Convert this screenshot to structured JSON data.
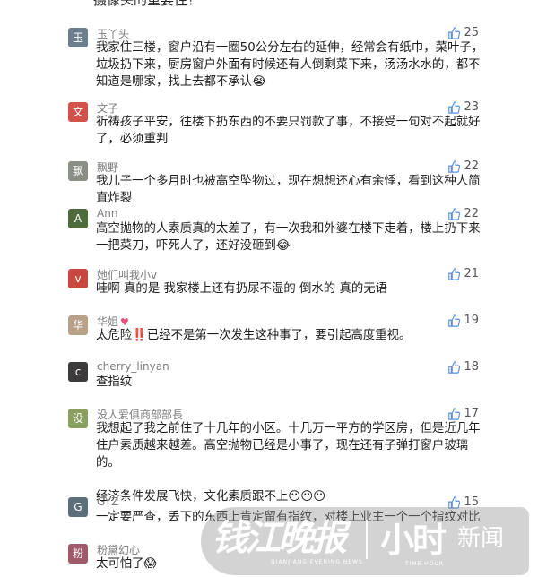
{
  "top_cutoff_text": "摄像头的重要性！",
  "comments": [
    {
      "username": "玉丫头",
      "likes": "25",
      "text": "我家住三楼，窗户沿有一圈50公分左右的延伸，经常会有纸巾，菜叶子，垃圾扔下来，厨房窗户外面有时候还有人倒剩菜下来，汤汤水水的，都不知道是哪家，找上去都不承认😭",
      "avatar_color": "#6b7f8c"
    },
    {
      "username": "文子",
      "likes": "23",
      "text": "祈祷孩子平安，往楼下扔东西的不要只罚款了事，不接受一句对不起就好了，必须重判",
      "avatar_color": "#d2524a"
    },
    {
      "username": "飘野",
      "likes": "22",
      "text": "我儿子一个多月时也被高空坠物过，现在想想还心有余悸，看到这种人简直炸裂",
      "avatar_color": "#8a8f86"
    },
    {
      "username": "Ann",
      "likes": "22",
      "text": "高空抛物的人素质真的太差了，有一次我和外婆在楼下走着，楼上扔下来一把菜刀，吓死人了，还好没砸到😂",
      "avatar_color": "#4e6b3b"
    },
    {
      "username": "她们叫我小v",
      "likes": "21",
      "text": "哇啊 真的是 我家楼上还有扔尿不湿的 倒水的 真的无语",
      "avatar_color": "#c9473f"
    },
    {
      "username": "华姐",
      "likes": "19",
      "text": "太危险‼️已经不是第一次发生这种事了，要引起高度重视。",
      "avatar_color": "#b9a089"
    },
    {
      "username": "cherry_linyan",
      "likes": "18",
      "text": "查指纹",
      "avatar_color": "#3c3a3a"
    },
    {
      "username": "没人爱俱商部部長",
      "likes": "17",
      "text": "我想起了我之前住了十几年的小区。十几万一平方的学区房，但是近几年住户素质越来越差。高空抛物已经是小事了，现在还有子弹打窗户玻璃的。\n\n经济条件发展飞快，文化素质跟不上😶😶😶",
      "avatar_color": "#8aa05e"
    },
    {
      "username": "GYZ",
      "likes": "15",
      "text": "一定要严查，丢下的东西上肯定留有指纹，对楼上业主一个一个指纹对比",
      "avatar_color": "#5a6f7a"
    },
    {
      "username": "粉黛幻心",
      "likes": "",
      "text": "太可怕了😱",
      "avatar_color": "#a0596b"
    }
  ],
  "watermark": {
    "brand": "钱江晚报",
    "brand_sub": "QIANJIANG EVENING NEWS",
    "hours": "小时",
    "hours_sub": "TIME HOUR",
    "news": "新闻"
  }
}
